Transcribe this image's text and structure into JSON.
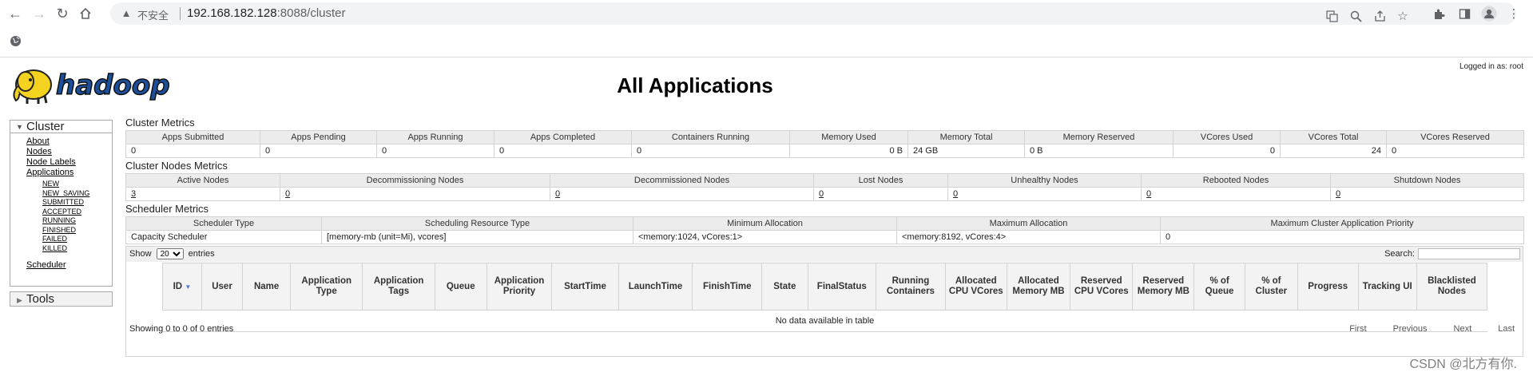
{
  "browser": {
    "insecure_label": "不安全",
    "url_host": "192.168.182.128",
    "url_port": ":8088",
    "url_path": "/cluster"
  },
  "header": {
    "title": "All Applications",
    "logged_in": "Logged in as: root",
    "logo_text": "hadoop"
  },
  "sidebar": {
    "cluster_label": "Cluster",
    "links": {
      "about": "About",
      "nodes": "Nodes",
      "node_labels": "Node Labels",
      "applications": "Applications",
      "scheduler": "Scheduler"
    },
    "states": [
      "NEW",
      "NEW_SAVING",
      "SUBMITTED",
      "ACCEPTED",
      "RUNNING",
      "FINISHED",
      "FAILED",
      "KILLED"
    ],
    "tools_label": "Tools"
  },
  "cluster_metrics": {
    "title": "Cluster Metrics",
    "headers": [
      "Apps Submitted",
      "Apps Pending",
      "Apps Running",
      "Apps Completed",
      "Containers Running",
      "Memory Used",
      "Memory Total",
      "Memory Reserved",
      "VCores Used",
      "VCores Total",
      "VCores Reserved"
    ],
    "values": [
      "0",
      "0",
      "0",
      "0",
      "0",
      "0 B",
      "24 GB",
      "0 B",
      "0",
      "24",
      "0"
    ]
  },
  "node_metrics": {
    "title": "Cluster Nodes Metrics",
    "headers": [
      "Active Nodes",
      "Decommissioning Nodes",
      "Decommissioned Nodes",
      "Lost Nodes",
      "Unhealthy Nodes",
      "Rebooted Nodes",
      "Shutdown Nodes"
    ],
    "values": [
      "3",
      "0",
      "0",
      "0",
      "0",
      "0",
      "0"
    ]
  },
  "scheduler_metrics": {
    "title": "Scheduler Metrics",
    "headers": [
      "Scheduler Type",
      "Scheduling Resource Type",
      "Minimum Allocation",
      "Maximum Allocation",
      "Maximum Cluster Application Priority"
    ],
    "values": [
      "Capacity Scheduler",
      "[memory-mb (unit=Mi), vcores]",
      "<memory:1024, vCores:1>",
      "<memory:8192, vCores:4>",
      "0"
    ]
  },
  "apps_table": {
    "show_label": "Show",
    "entries_label": "entries",
    "page_size": "20",
    "search_label": "Search:",
    "columns": [
      "ID",
      "User",
      "Name",
      "Application Type",
      "Application Tags",
      "Queue",
      "Application Priority",
      "StartTime",
      "LaunchTime",
      "FinishTime",
      "State",
      "FinalStatus",
      "Running Containers",
      "Allocated CPU VCores",
      "Allocated Memory MB",
      "Reserved CPU VCores",
      "Reserved Memory MB",
      "% of Queue",
      "% of Cluster",
      "Progress",
      "Tracking UI",
      "Blacklisted Nodes"
    ],
    "empty_message": "No data available in table",
    "info": "Showing 0 to 0 of 0 entries",
    "pager": {
      "first": "First",
      "previous": "Previous",
      "next": "Next",
      "last": "Last"
    }
  },
  "watermark": "CSDN @北方有你."
}
